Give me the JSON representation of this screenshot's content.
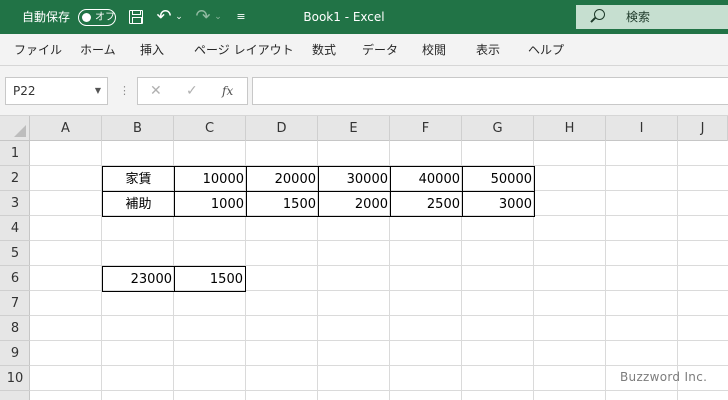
{
  "titlebar": {
    "autosave_label": "自動保存",
    "autosave_state": "オフ",
    "doc_title": "Book1  -  Excel",
    "search_placeholder": "検索",
    "theme_color": "#217346"
  },
  "ribbon": {
    "tabs": [
      "ファイル",
      "ホーム",
      "挿入",
      "ページ レイアウト",
      "数式",
      "データ",
      "校閲",
      "表示",
      "ヘルプ"
    ]
  },
  "formula_bar": {
    "name_box": "P22",
    "fx_label": "fx",
    "formula": ""
  },
  "sheet": {
    "columns": [
      "A",
      "B",
      "C",
      "D",
      "E",
      "F",
      "G",
      "H",
      "I",
      "J"
    ],
    "rows": [
      "1",
      "2",
      "3",
      "4",
      "5",
      "6",
      "7",
      "8",
      "9",
      "10"
    ],
    "row2": {
      "label": "家賃",
      "values": [
        "10000",
        "20000",
        "30000",
        "40000",
        "50000"
      ]
    },
    "row3": {
      "label": "補助",
      "values": [
        "1000",
        "1500",
        "2000",
        "2500",
        "3000"
      ]
    },
    "row6": {
      "b": "23000",
      "c": "1500"
    }
  },
  "watermark": "Buzzword Inc."
}
